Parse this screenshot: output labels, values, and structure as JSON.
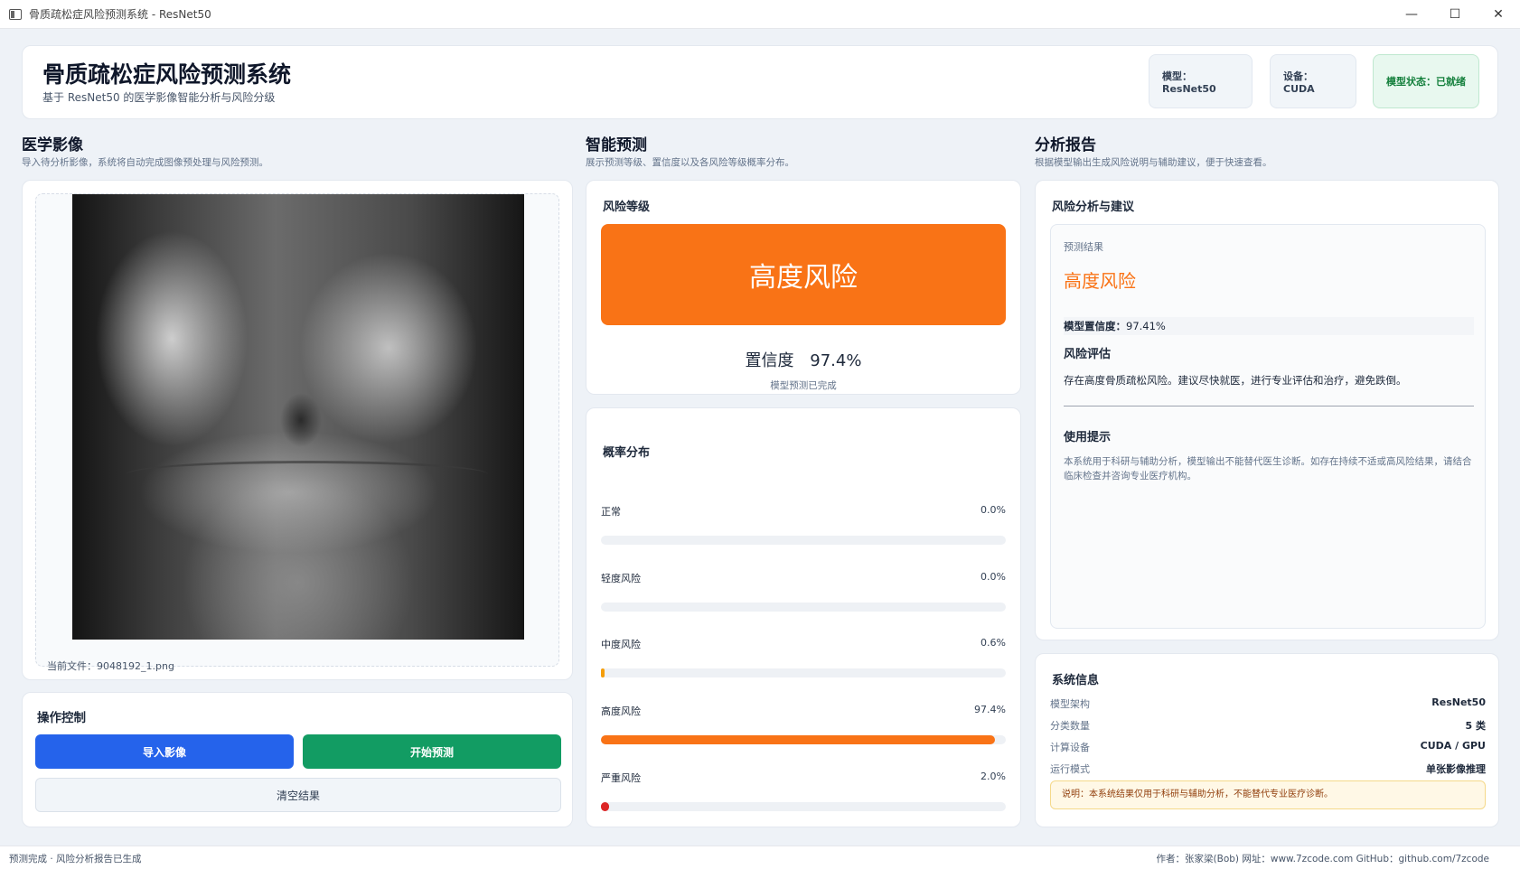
{
  "window": {
    "title": "骨质疏松症风险预测系统 - ResNet50",
    "minimize": "—",
    "maximize": "☐",
    "close": "✕"
  },
  "header": {
    "title": "骨质疏松症风险预测系统",
    "subtitle": "基于 ResNet50 的医学影像智能分析与风险分级",
    "model_pill": "模型：ResNet50",
    "device_pill": "设备：CUDA",
    "status_pill": "模型状态：已就绪"
  },
  "image_section": {
    "title": "医学影像",
    "subtitle": "导入待分析影像，系统将自动完成图像预处理与风险预测。",
    "current_file": "当前文件：9048192_1.png"
  },
  "controls": {
    "title": "操作控制",
    "import_label": "导入影像",
    "predict_label": "开始预测",
    "clear_label": "清空结果"
  },
  "prediction_section": {
    "title": "智能预测",
    "subtitle": "展示预测等级、置信度以及各风险等级概率分布。",
    "risk_card_title": "风险等级",
    "risk_level": "高度风险",
    "confidence_label": "置信度",
    "confidence_value": "97.4%",
    "status_note": "模型预测已完成",
    "prob_card_title": "概率分布",
    "probabilities": [
      {
        "label": "正常",
        "value_text": "0.0%",
        "value": 0.0,
        "color": "#94a3b8"
      },
      {
        "label": "轻度风险",
        "value_text": "0.0%",
        "value": 0.0,
        "color": "#94a3b8"
      },
      {
        "label": "中度风险",
        "value_text": "0.6%",
        "value": 0.6,
        "color": "#f59e0b"
      },
      {
        "label": "高度风险",
        "value_text": "97.4%",
        "value": 97.4,
        "color": "#f97316"
      },
      {
        "label": "严重风险",
        "value_text": "2.0%",
        "value": 2.0,
        "color": "#dc2626"
      }
    ]
  },
  "report_section": {
    "title": "分析报告",
    "subtitle": "根据模型输出生成风险说明与辅助建议，便于快速查看。",
    "card_title": "风险分析与建议",
    "result_label": "预测结果",
    "result_value": "高度风险",
    "conf_label": "模型置信度：",
    "conf_value": "97.41%",
    "assessment_title": "风险评估",
    "assessment_text": "存在高度骨质疏松风险。建议尽快就医，进行专业评估和治疗，避免跌倒。",
    "tips_title": "使用提示",
    "tips_text": "本系统用于科研与辅助分析，模型输出不能替代医生诊断。如存在持续不适或高风险结果，请结合临床检查并咨询专业医疗机构。"
  },
  "system_info": {
    "title": "系统信息",
    "rows": [
      {
        "key": "模型架构",
        "value": "ResNet50"
      },
      {
        "key": "分类数量",
        "value": "5 类"
      },
      {
        "key": "计算设备",
        "value": "CUDA / GPU"
      },
      {
        "key": "运行模式",
        "value": "单张影像推理"
      }
    ],
    "notice": "说明：本系统结果仅用于科研与辅助分析，不能替代专业医疗诊断。"
  },
  "statusbar": {
    "left": "预测完成 · 风险分析报告已生成",
    "right": "作者：张家梁(Bob)  网址：www.7zcode.com  GitHub：github.com/7zcode"
  },
  "colors": {
    "accent_blue": "#2563eb",
    "accent_green": "#129c63",
    "risk_orange": "#f97316"
  }
}
